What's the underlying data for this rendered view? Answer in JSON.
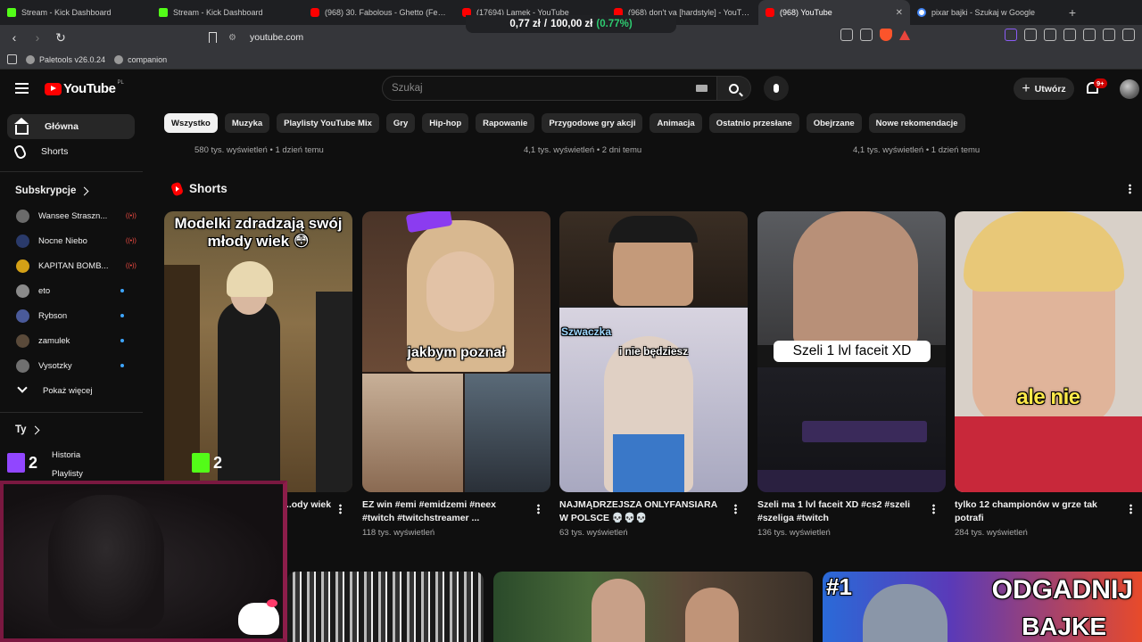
{
  "browser": {
    "tabs": [
      {
        "title": "Stream - Kick Dashboard",
        "favicon": "kick",
        "active": false
      },
      {
        "title": "Stream - Kick Dashboard",
        "favicon": "kick",
        "active": false
      },
      {
        "title": "(968) 30. Fabolous - Ghetto (Feat. Th",
        "favicon": "youtube",
        "active": false
      },
      {
        "title": "(17694) Lamek - YouTube",
        "favicon": "youtube",
        "active": false
      },
      {
        "title": "(968) don't ya [hardstyle] - YouTube",
        "favicon": "youtube",
        "active": false
      },
      {
        "title": "(968) YouTube",
        "favicon": "youtube",
        "active": true
      },
      {
        "title": "pixar bajki - Szukaj w Google",
        "favicon": "google",
        "active": false
      }
    ],
    "price_widget": {
      "value": "0,77 zł",
      "sep": "/",
      "target": "100,00 zł",
      "pct": "(0.77%)"
    },
    "url": "youtube.com",
    "bookmarks": [
      {
        "label": "Paletools v26.0.24"
      },
      {
        "label": "companion"
      }
    ]
  },
  "header": {
    "logo_text": "YouTube",
    "logo_country": "PL",
    "search_placeholder": "Szukaj",
    "create_label": "Utwórz",
    "notification_badge": "9+"
  },
  "sidebar": {
    "main": [
      {
        "label": "Główna",
        "icon": "home-icon",
        "active": true
      },
      {
        "label": "Shorts",
        "icon": "shorts-icon",
        "active": false
      }
    ],
    "subscriptions_title": "Subskrypcje",
    "subscriptions": [
      {
        "name": "Wansee Straszn...",
        "status": "live",
        "color": "#6b6b6b"
      },
      {
        "name": "Nocne Niebo",
        "status": "live",
        "color": "#2a3a6a"
      },
      {
        "name": "KAPITAN BOMB...",
        "status": "live",
        "color": "#d4a016"
      },
      {
        "name": "eto",
        "status": "new",
        "color": "#8a8a8a"
      },
      {
        "name": "Rybson",
        "status": "new",
        "color": "#4a5a9a"
      },
      {
        "name": "zamulek",
        "status": "new",
        "color": "#5a4a3a"
      },
      {
        "name": "Vysotzky",
        "status": "new",
        "color": "#707070"
      }
    ],
    "show_more": "Pokaż więcej",
    "you_title": "Ty",
    "you_items": [
      {
        "label": "Historia"
      },
      {
        "label": "Playlisty"
      }
    ]
  },
  "chips": [
    "Wszystko",
    "Muzyka",
    "Playlisty YouTube Mix",
    "Gry",
    "Hip-hop",
    "Rapowanie",
    "Przygodowe gry akcji",
    "Animacja",
    "Ostatnio przesłane",
    "Obejrzane",
    "Nowe rekomendacje"
  ],
  "previous_row_meta": [
    "580 tys. wyświetleń • 1 dzień temu",
    "4,1 tys. wyświetleń • 2 dni temu",
    "4,1 tys. wyświetleń • 1 dzień temu"
  ],
  "shorts": {
    "section_title": "Shorts",
    "items": [
      {
        "overlay": "Modelki zdradzają swój młody wiek 😳",
        "title_visible": "...ody wiek",
        "views": ""
      },
      {
        "overlay": "jakbym poznał",
        "title": "EZ win #emi #emidzemi #neex #twitch #twitchstreamer ...",
        "views": "118 tys. wyświetleń"
      },
      {
        "overlay_top": "Szwaczka",
        "overlay": "i nie będziesz",
        "title": "NAJMĄDRZEJSZA ONLYFANSIARA W POLSCE 💀💀💀",
        "views": "63 tys. wyświetleń"
      },
      {
        "overlay": "Szeli 1 lvl faceit XD",
        "title": "Szeli ma 1 lvl faceit XD #cs2 #szeli #szeliga #twitch",
        "views": "136 tys. wyświetleń"
      },
      {
        "overlay": "ale nie",
        "title": "tylko 12 championów w grze tak potrafi",
        "views": "284 tys. wyświetleń"
      }
    ]
  },
  "stream_overlay": {
    "kick_count": "2",
    "twitch_count": "2"
  },
  "bottom_thumbs": {
    "last_text_a": "#1",
    "last_text_b": "ODGADNIJ",
    "last_text_c": "BAJKE"
  }
}
